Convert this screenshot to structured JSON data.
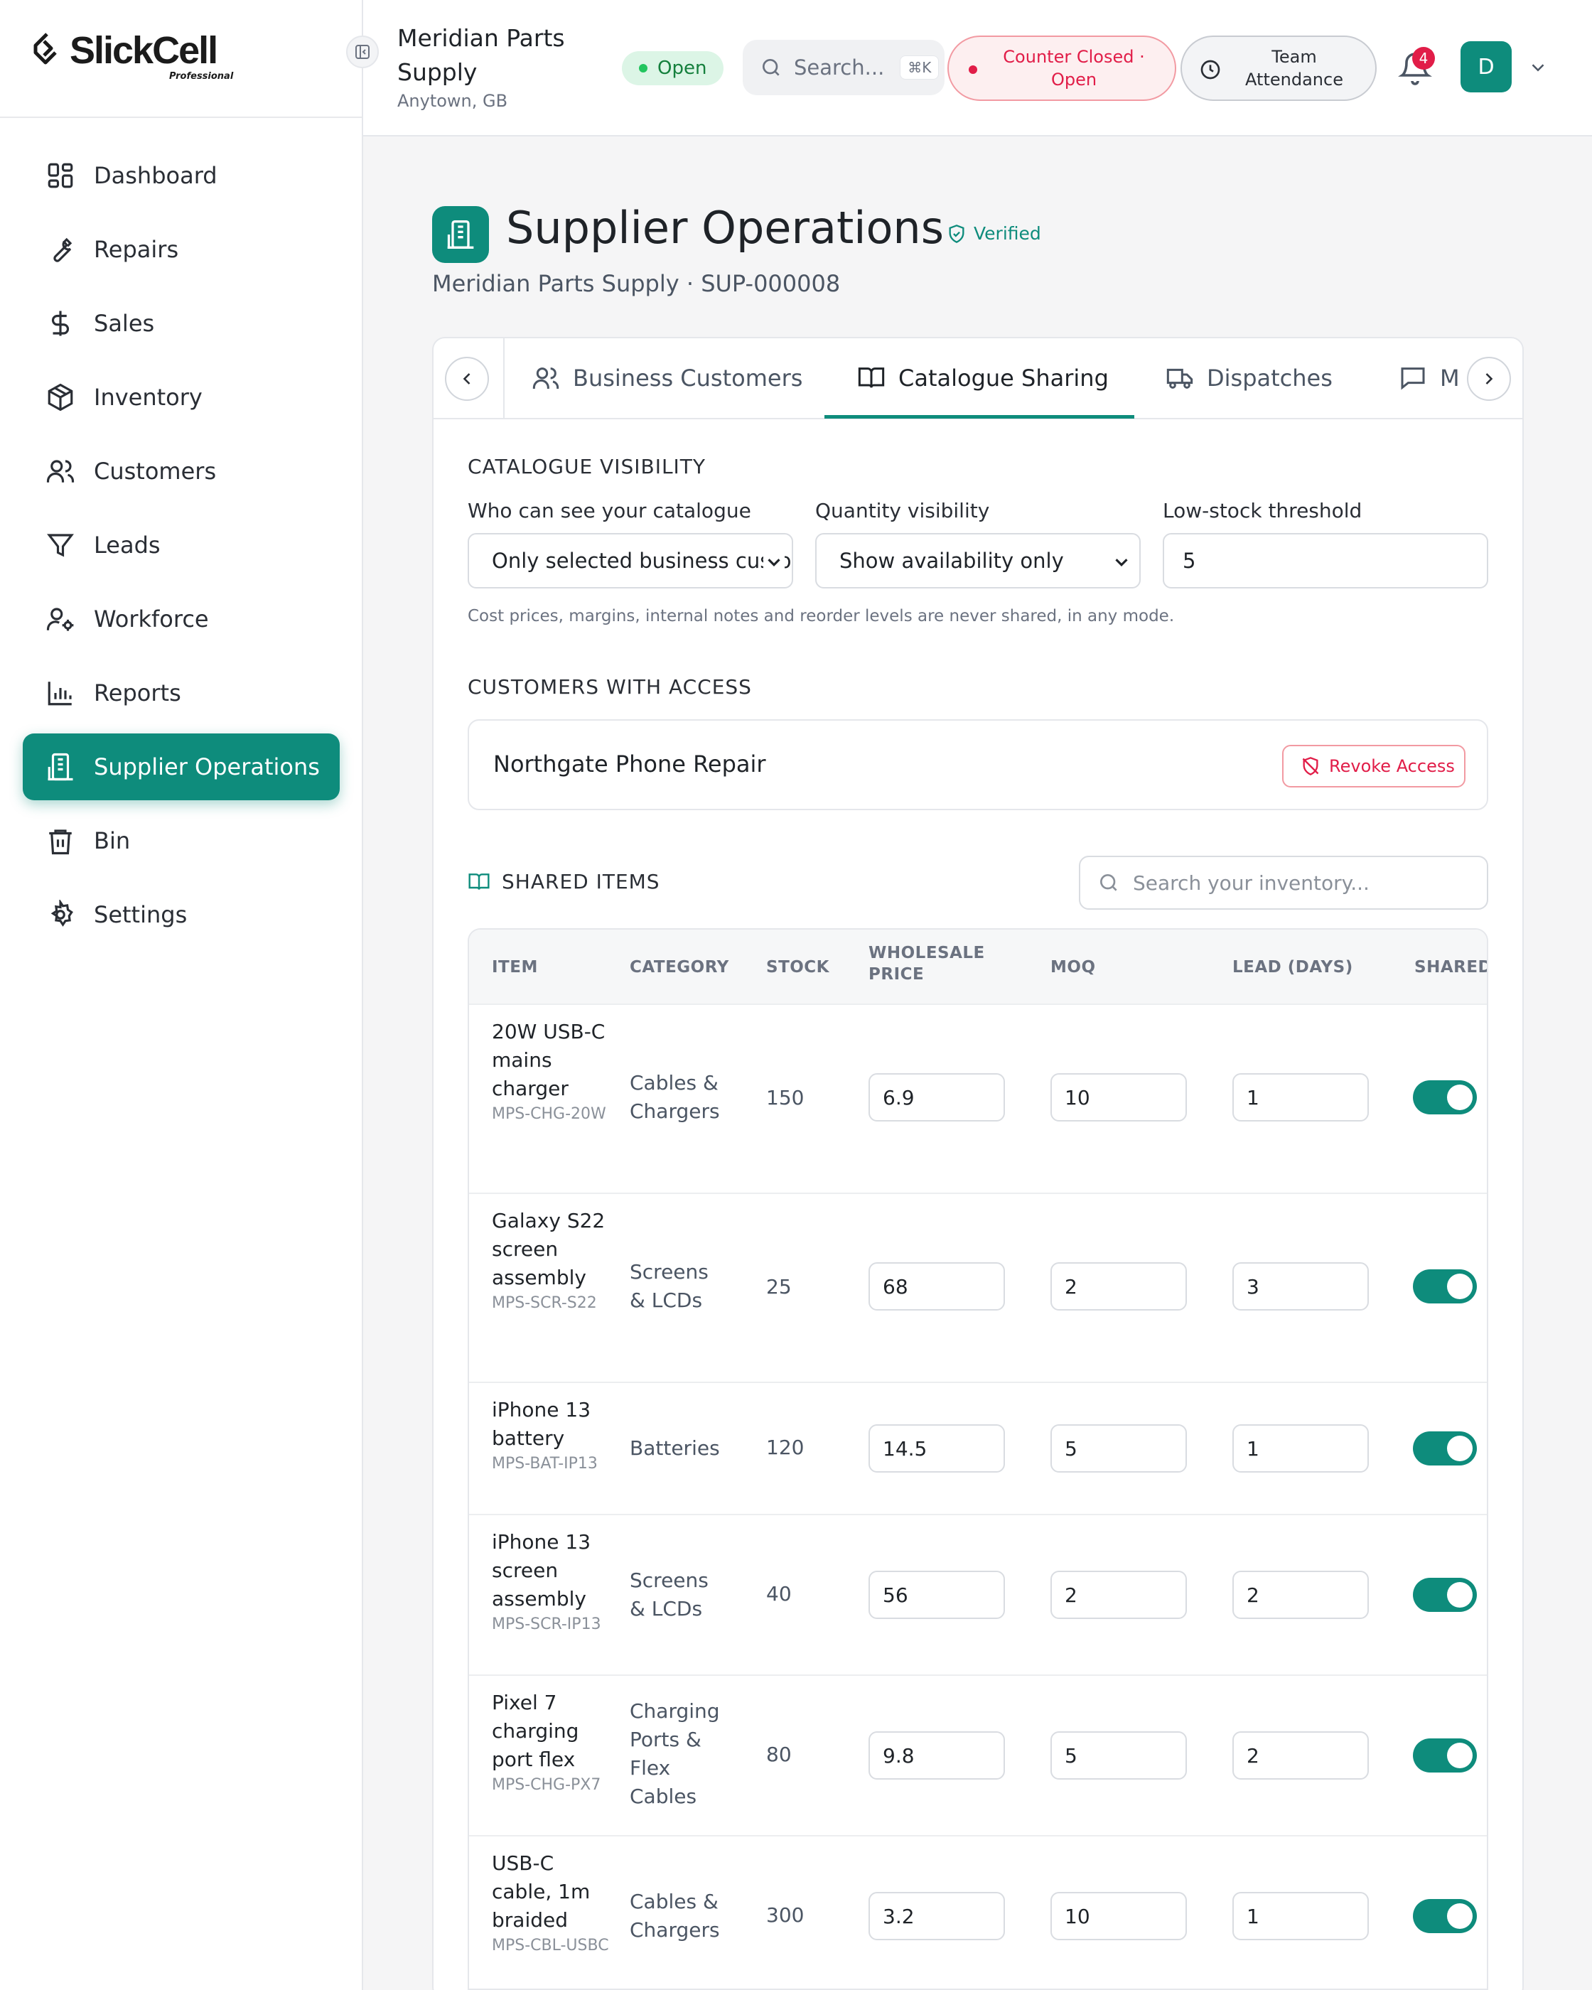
{
  "brand": {
    "name": "SlickCell",
    "tagline": "Professional"
  },
  "sidebar": {
    "items": [
      {
        "label": "Dashboard",
        "icon": "dashboard-icon",
        "active": false
      },
      {
        "label": "Repairs",
        "icon": "wrench-icon",
        "active": false
      },
      {
        "label": "Sales",
        "icon": "dollar-icon",
        "active": false
      },
      {
        "label": "Inventory",
        "icon": "box-icon",
        "active": false
      },
      {
        "label": "Customers",
        "icon": "users-icon",
        "active": false
      },
      {
        "label": "Leads",
        "icon": "funnel-icon",
        "active": false
      },
      {
        "label": "Workforce",
        "icon": "user-gear-icon",
        "active": false
      },
      {
        "label": "Reports",
        "icon": "bar-chart-icon",
        "active": false
      },
      {
        "label": "Supplier Operations",
        "icon": "building-icon",
        "active": true
      },
      {
        "label": "Bin",
        "icon": "trash-icon",
        "active": false
      },
      {
        "label": "Settings",
        "icon": "gear-icon",
        "active": false
      }
    ]
  },
  "header": {
    "store_name": "Meridian Parts Supply",
    "store_location": "Anytown, GB",
    "status": "Open",
    "search_placeholder": "Search...",
    "search_shortcut": "⌘K",
    "counter_status": "Counter Closed · Open",
    "team_attendance": "Team Attendance",
    "notification_count": "4",
    "avatar_initial": "D",
    "colors": {
      "accent": "#0e8c7c",
      "danger": "#e11d48",
      "success": "#15803d"
    }
  },
  "page": {
    "title": "Supplier Operations",
    "verified": "Verified",
    "subtitle": "Meridian Parts Supply · SUP-000008"
  },
  "tabs": [
    {
      "label": "Business Customers",
      "icon": "users-icon",
      "active": false
    },
    {
      "label": "Catalogue Sharing",
      "icon": "book-open-icon",
      "active": true
    },
    {
      "label": "Dispatches",
      "icon": "truck-icon",
      "active": false
    },
    {
      "label": "M",
      "icon": "message-icon",
      "active": false
    }
  ],
  "visibility": {
    "section_title": "CATALOGUE VISIBILITY",
    "who_label": "Who can see your catalogue",
    "who_value": "Only selected business customers",
    "quantity_label": "Quantity visibility",
    "quantity_value": "Show availability only",
    "threshold_label": "Low-stock threshold",
    "threshold_value": "5",
    "hint": "Cost prices, margins, internal notes and reorder levels are never shared, in any mode."
  },
  "access": {
    "section_title": "CUSTOMERS WITH ACCESS",
    "customers": [
      {
        "name": "Northgate Phone Repair",
        "action": "Revoke Access"
      }
    ]
  },
  "shared": {
    "section_title": "SHARED ITEMS",
    "search_placeholder": "Search your inventory...",
    "columns": [
      "ITEM",
      "CATEGORY",
      "STOCK",
      "WHOLESALE PRICE",
      "MOQ",
      "LEAD (DAYS)",
      "SHARED"
    ],
    "rows": [
      {
        "name": "20W USB-C mains charger",
        "sku": "MPS-CHG-20W",
        "category": "Cables & Chargers",
        "stock": "150",
        "price": "6.9",
        "moq": "10",
        "lead": "1",
        "shared": true
      },
      {
        "name": "Galaxy S22 screen assembly",
        "sku": "MPS-SCR-S22",
        "category": "Screens & LCDs",
        "stock": "25",
        "price": "68",
        "moq": "2",
        "lead": "3",
        "shared": true
      },
      {
        "name": "iPhone 13 battery",
        "sku": "MPS-BAT-IP13",
        "category": "Batteries",
        "stock": "120",
        "price": "14.5",
        "moq": "5",
        "lead": "1",
        "shared": true
      },
      {
        "name": "iPhone 13 screen assembly",
        "sku": "MPS-SCR-IP13",
        "category": "Screens & LCDs",
        "stock": "40",
        "price": "56",
        "moq": "2",
        "lead": "2",
        "shared": true
      },
      {
        "name": "Pixel 7 charging port flex",
        "sku": "MPS-CHG-PX7",
        "category": "Charging Ports & Flex Cables",
        "stock": "80",
        "price": "9.8",
        "moq": "5",
        "lead": "2",
        "shared": true
      },
      {
        "name": "USB-C cable, 1m braided",
        "sku": "MPS-CBL-USBC",
        "category": "Cables & Chargers",
        "stock": "300",
        "price": "3.2",
        "moq": "10",
        "lead": "1",
        "shared": true
      }
    ]
  }
}
